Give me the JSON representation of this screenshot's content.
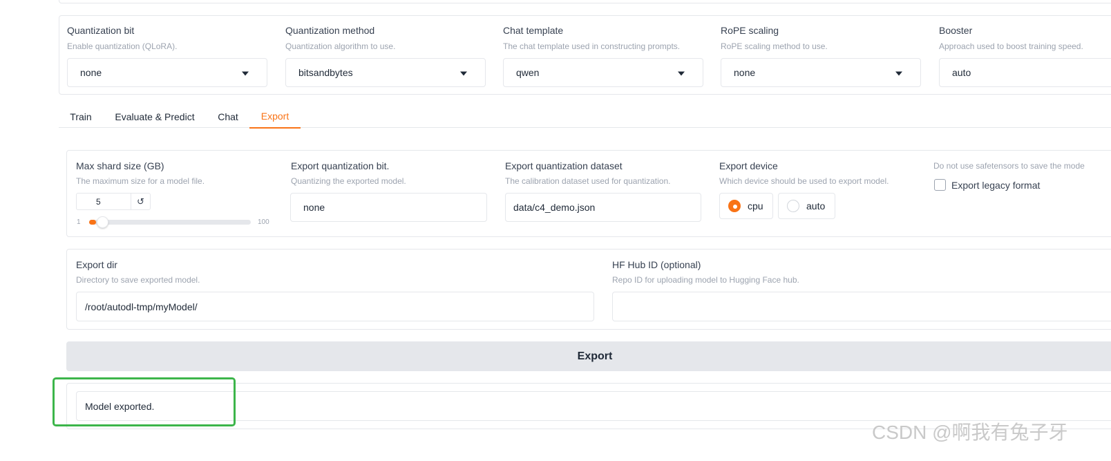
{
  "top_settings": {
    "quantization_bit": {
      "label": "Quantization bit",
      "info": "Enable quantization (QLoRA).",
      "value": "none"
    },
    "quantization_method": {
      "label": "Quantization method",
      "info": "Quantization algorithm to use.",
      "value": "bitsandbytes"
    },
    "chat_template": {
      "label": "Chat template",
      "info": "The chat template used in constructing prompts.",
      "value": "qwen"
    },
    "rope_scaling": {
      "label": "RoPE scaling",
      "info": "RoPE scaling method to use.",
      "value": "none"
    },
    "booster": {
      "label": "Booster",
      "info": "Approach used to boost training speed.",
      "value": "auto"
    }
  },
  "tabs": [
    "Train",
    "Evaluate & Predict",
    "Chat",
    "Export"
  ],
  "active_tab": "Export",
  "export": {
    "max_shard_size": {
      "label": "Max shard size (GB)",
      "info": "The maximum size for a model file.",
      "value": "5",
      "min": "1",
      "max": "100",
      "reset_icon": "↺"
    },
    "export_quantization_bit": {
      "label": "Export quantization bit.",
      "info": "Quantizing the exported model.",
      "value": "none"
    },
    "export_quantization_dataset": {
      "label": "Export quantization dataset",
      "info": "The calibration dataset used for quantization.",
      "value": "data/c4_demo.json"
    },
    "export_device": {
      "label": "Export device",
      "info": "Which device should be used to export model.",
      "options": [
        "cpu",
        "auto"
      ],
      "selected": "cpu"
    },
    "export_legacy_format": {
      "info": "Do not use safetensors to save the mode",
      "label": "Export legacy format",
      "checked": false
    },
    "export_dir": {
      "label": "Export dir",
      "info": "Directory to save exported model.",
      "value": "/root/autodl-tmp/myModel/"
    },
    "hf_hub_id": {
      "label": "HF Hub ID (optional)",
      "info": "Repo ID for uploading model to Hugging Face hub.",
      "value": ""
    },
    "export_button": "Export",
    "output": "Model exported."
  },
  "watermark": "CSDN @啊我有兔子牙",
  "colors": {
    "accent": "#f97316",
    "highlight": "#3cb54a",
    "button_bg": "#e5e7eb"
  }
}
